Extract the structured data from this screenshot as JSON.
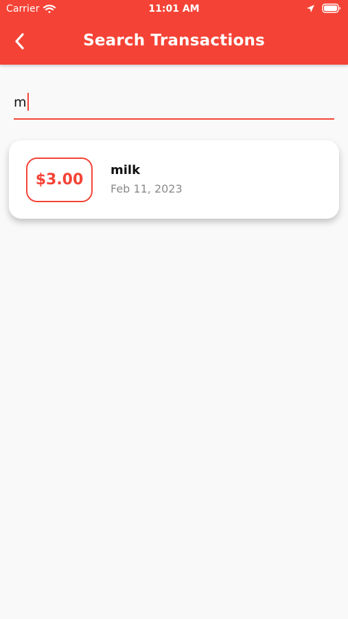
{
  "status_bar": {
    "carrier": "Carrier",
    "time": "11:01 AM"
  },
  "header": {
    "title": "Search Transactions",
    "background_color": "#f44336",
    "back_icon": "chevron-left-icon"
  },
  "search": {
    "value": "m",
    "underline_color": "#f44336"
  },
  "results": [
    {
      "amount": "$3.00",
      "title": "milk",
      "date": "Feb 11, 2023"
    }
  ],
  "colors": {
    "accent": "#f44336",
    "background": "#f9f9f9",
    "card": "#ffffff",
    "date_text": "#8a8a8a"
  }
}
